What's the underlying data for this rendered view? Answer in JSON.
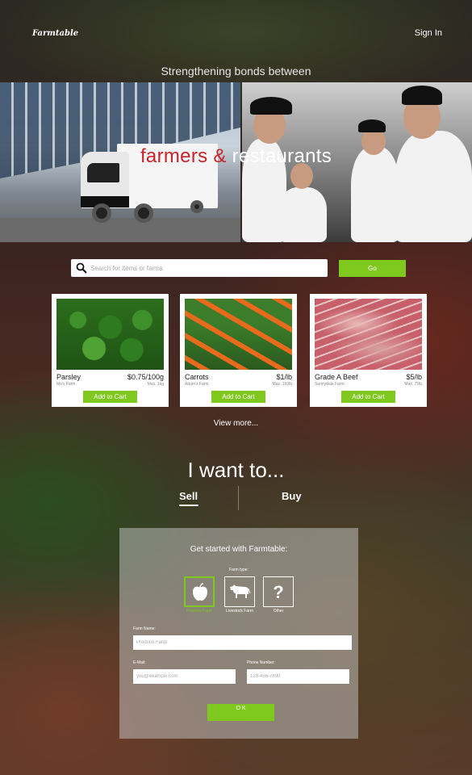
{
  "header": {
    "logo": "Farmtable",
    "sign_in": "Sign In"
  },
  "hero": {
    "tagline": "Strengthening bonds between",
    "title_part1": "farmers ",
    "title_amp": "&",
    "title_part2": " restaurants"
  },
  "search": {
    "placeholder": "Search for items or farms",
    "value": "",
    "go_label": "Go"
  },
  "products": [
    {
      "name": "Parsley",
      "price": "$0.75/100g",
      "farm": "Mo's Farm",
      "max": "Max. 1kg",
      "button": "Add to Cart",
      "image": "parsley-photo"
    },
    {
      "name": "Carrots",
      "price": "$1/lb",
      "farm": "Adam's Farm",
      "max": "Max. 150lb",
      "button": "Add to Cart",
      "image": "carrots-photo"
    },
    {
      "name": "Grade A Beef",
      "price": "$5/lb",
      "farm": "Sunnydale Farm",
      "max": "Max. 75lb",
      "button": "Add to Cart",
      "image": "beef-photo"
    }
  ],
  "view_more": "View more...",
  "intent": {
    "heading": "I want to...",
    "tabs": [
      {
        "label": "Sell",
        "active": true
      },
      {
        "label": "Buy",
        "active": false
      }
    ]
  },
  "signup": {
    "title": "Get started with Farmtable:",
    "farm_type_label": "Farm type:",
    "farm_types": [
      {
        "label": "Produce Farm",
        "icon": "apple-icon",
        "selected": true
      },
      {
        "label": "Livestock Farm",
        "icon": "cow-icon",
        "selected": false
      },
      {
        "label": "Other",
        "icon": "question-mark-icon",
        "selected": false
      }
    ],
    "farm_name_label": "Farm Name:",
    "farm_name_placeholder": "Produce Farm",
    "email_label": "E-Mail:",
    "email_placeholder": "you@example.com",
    "phone_label": "Phone Number:",
    "phone_placeholder": "123-456-7890",
    "submit_label": "O K"
  },
  "colors": {
    "accent_green": "#7fc91f",
    "title_red": "#c8232a"
  }
}
